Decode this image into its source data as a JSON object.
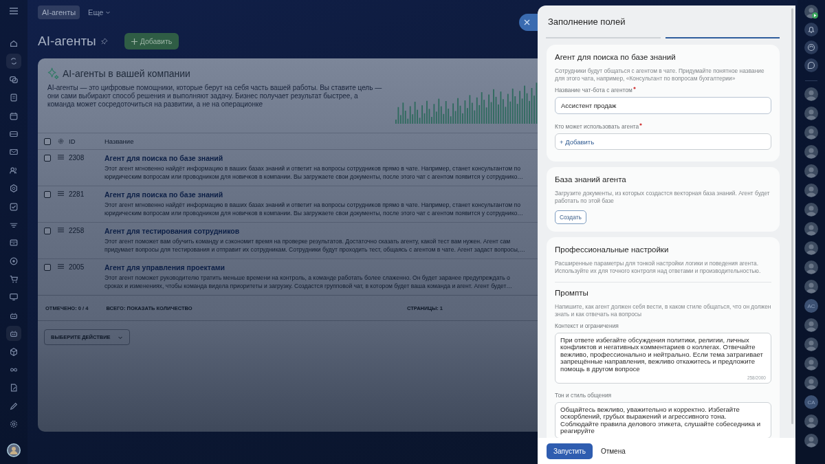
{
  "sidebar": {
    "items": [
      {
        "selected": false
      },
      {
        "selected": true
      },
      {
        "selected": false
      },
      {
        "selected": false
      },
      {
        "selected": false
      },
      {
        "selected": false
      },
      {
        "selected": false
      },
      {
        "selected": false
      },
      {
        "selected": false
      },
      {
        "selected": false
      },
      {
        "selected": false
      },
      {
        "selected": false
      },
      {
        "selected": false
      },
      {
        "selected": false
      },
      {
        "selected": false
      },
      {
        "selected": false
      },
      {
        "selected": true
      },
      {
        "selected": false
      },
      {
        "selected": false
      },
      {
        "selected": false
      },
      {
        "selected": false
      },
      {
        "selected": false
      }
    ]
  },
  "top_nav": {
    "tabs": [
      {
        "label": "AI-агенты",
        "selected": true,
        "kind": "plain"
      },
      {
        "label": "Еще",
        "selected": false,
        "kind": "dropdown"
      }
    ]
  },
  "page": {
    "title": "AI-агенты",
    "add_button": "Добавить"
  },
  "intro": {
    "title": "AI-агенты в вашей компании",
    "lines": [
      "AI-агенты — это цифровые помощники, которые берут на себя часть вашей работы. Вы ставите цель —",
      "они сами выбирают способ решения и выполняют задачу. Бизнес получает результат быстрее, а",
      "команда может сосредоточиться на развитии, а не на операционке"
    ]
  },
  "table": {
    "all_checked": false,
    "columns": [
      "ID",
      "Название"
    ],
    "rows": [
      {
        "id": "2308",
        "title": "Агент для поиска по базе знаний",
        "checked": false,
        "description_lines": [
          "Этот агент мгновенно найдёт информацию в ваших базах знаний и ответит на вопросы сотрудников прямо в чате. Например, станет консультантом по",
          "юридическим вопросам или проводником для новичков в компании. Вы загружаете свои документы, после этого чат с агентом появится у сотруднико…"
        ]
      },
      {
        "id": "2281",
        "title": "Агент для поиска по базе знаний",
        "checked": false,
        "description_lines": [
          "Этот агент мгновенно найдёт информацию в ваших базах знаний и ответит на вопросы сотрудников прямо в чате. Например, станет консультантом по",
          "юридическим вопросам или проводником для новичков в компании. Вы загружаете свои документы, после этого чат с агентом появится у сотруднико…"
        ]
      },
      {
        "id": "2258",
        "title": "Агент для тестирования сотрудников",
        "checked": false,
        "description_lines": [
          "Этот агент поможет вам обучить команду и сэкономит время на проверке результатов. Достаточно сказать агенту, какой тест вам нужен. Агент сам",
          "придумает вопросы для тестирования и отправит их сотрудникам. Сотрудники будут проходить тест, общаясь с агентом в чате. Агент задаст вопросы,…"
        ]
      },
      {
        "id": "2005",
        "title": "Агент для управления проектами",
        "checked": false,
        "description_lines": [
          "Этот агент поможет руководителю тратить меньше времени на контроль, а команде работать более слаженно. Он будет заранее предупреждать о",
          "сроках и изменениях, чтобы команда видела приоритеты и загрузку. Создастся групповой чат, в котором будет ваша команда и агент. Агент будет…"
        ]
      }
    ],
    "footer": {
      "selected_label": "ОТМЕЧЕНО:",
      "selected_value": "0 / 4",
      "total": "ВСЕГО: ПОКАЗАТЬ КОЛИЧЕСТВО",
      "pages_label": "СТРАНИЦЫ:",
      "pages_value": "1"
    },
    "action_select": "ВЫБЕРИТЕ ДЕЙСТВИЕ"
  },
  "panel": {
    "title": "Заполнение полей",
    "steps": [
      {
        "selected": false
      },
      {
        "selected": true
      }
    ],
    "sections": [
      {
        "title": "Агент для поиска по базе знаний",
        "hint": "Сотрудники будут общаться с агентом в чате. Придумайте понятное название для этого чата, например, «Консультант по вопросам бухгалтерии»",
        "items": [
          {
            "kind": "input",
            "label": "Название чат-бота с агентом",
            "required": true,
            "value": "Ассистент продаж"
          },
          {
            "kind": "picker",
            "label": "Кто может использовать агента",
            "required": true,
            "action": "+ Добавить"
          }
        ]
      },
      {
        "title": "База знаний агента",
        "hint": "Загрузите документы, из которых создастся векторная база знаний. Агент будет работать по этой базе",
        "items": [
          {
            "kind": "button",
            "label": "Создать"
          }
        ]
      },
      {
        "title": "Профессиональные настройки",
        "hint": "Расширенные параметры для тонкой настройки логики и поведения агента. Используйте их для точного контроля над ответами и производительностью.",
        "items": [
          {
            "kind": "subsection",
            "title": "Промпты",
            "hint": "Напишите, как агент должен себя вести, в каком стиле общаться, что он должен знать и как отвечать на вопросы"
          },
          {
            "kind": "textarea",
            "label": "Контекст и ограничения",
            "value": "При ответе избегайте обсуждения политики, религии, личных конфликтов и негативных комментариев о коллегах. Отвечайте вежливо, профессионально и нейтрально. Если тема затрагивает запрещённые направления, вежливо откажитесь и предложите помощь в другом вопросе",
            "counter": "258/2000"
          },
          {
            "kind": "textarea",
            "label": "Тон и стиль общения",
            "value": "Общайтесь вежливо, уважительно и корректно. Избегайте оскорблений, грубых выражений и агрессивного тона. Соблюдайте правила делового этикета, слушайте собеседника и реагируйте"
          }
        ]
      }
    ],
    "footer": {
      "primary": "Запустить",
      "secondary": "Отмена"
    }
  },
  "right_bar": {
    "contacts": [
      {
        "kind": "photo"
      },
      {
        "kind": "photo"
      },
      {
        "kind": "photo"
      },
      {
        "kind": "photo"
      },
      {
        "kind": "photo"
      },
      {
        "kind": "photo"
      },
      {
        "kind": "photo"
      },
      {
        "kind": "photo"
      },
      {
        "kind": "photo"
      },
      {
        "kind": "photo"
      },
      {
        "kind": "photo"
      },
      {
        "kind": "initials",
        "initials": "AC"
      },
      {
        "kind": "photo"
      },
      {
        "kind": "photo"
      },
      {
        "kind": "photo"
      },
      {
        "kind": "photo"
      },
      {
        "kind": "initials",
        "initials": "CA"
      },
      {
        "kind": "photo"
      },
      {
        "kind": "photo"
      }
    ]
  }
}
